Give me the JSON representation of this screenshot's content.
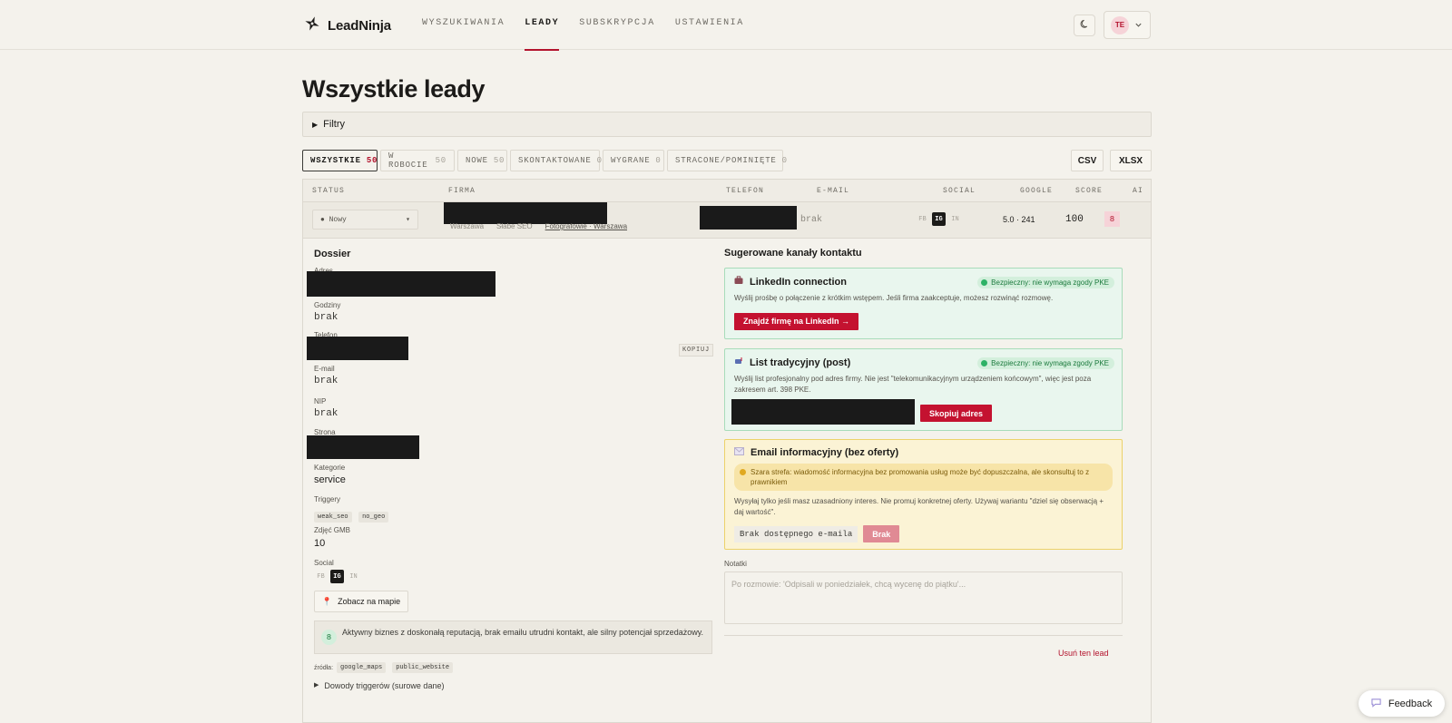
{
  "app": {
    "name": "LeadNinja"
  },
  "nav": {
    "items": [
      {
        "label": "WYSZUKIWANIA"
      },
      {
        "label": "LEADY"
      },
      {
        "label": "SUBSKRYPCJA"
      },
      {
        "label": "USTAWIENIA"
      }
    ],
    "user_initials": "TE"
  },
  "page": {
    "title": "Wszystkie leady",
    "filters_label": "Filtry"
  },
  "tabs": [
    {
      "label": "WSZYSTKIE",
      "count": "50"
    },
    {
      "label": "W ROBOCIE",
      "count": "50"
    },
    {
      "label": "NOWE",
      "count": "50"
    },
    {
      "label": "SKONTAKTOWANE",
      "count": "0"
    },
    {
      "label": "WYGRANE",
      "count": "0"
    },
    {
      "label": "STRACONE/POMINIĘTE",
      "count": "0"
    }
  ],
  "export": {
    "csv": "CSV",
    "xlsx": "XLSX"
  },
  "table": {
    "headers": {
      "status": "STATUS",
      "firma": "FIRMA",
      "telefon": "TELEFON",
      "email": "E-MAIL",
      "social": "SOCIAL",
      "google": "GOOGLE",
      "score": "SCORE",
      "ai": "AI"
    },
    "row": {
      "status": "Nowy",
      "firma_meta": {
        "city": "Warszawa",
        "tag": "Słabe SEO",
        "link": "Fotografowie · Warszawa"
      },
      "email": "brak",
      "social": {
        "fb": "FB",
        "ig": "IG",
        "in": "IN"
      },
      "google": "5.0 · 241",
      "score": "100",
      "ai": "8"
    }
  },
  "dossier": {
    "title": "Dossier",
    "adres_label": "Adres",
    "godziny_label": "Godziny",
    "godziny_value": "brak",
    "telefon_label": "Telefon",
    "copy_label": "KOPIUJ",
    "email_label": "E-mail",
    "email_value": "brak",
    "nip_label": "NIP",
    "nip_value": "brak",
    "strona_label": "Strona",
    "kategorie_label": "Kategorie",
    "kategorie_value": "service",
    "triggery_label": "Triggery",
    "triggery": [
      "weak_seo",
      "no_geo"
    ],
    "zdjecia_label": "Zdjęć GMB",
    "zdjecia_value": "10",
    "social_label": "Social",
    "map_button": "Zobacz na mapie",
    "ai_score": "8",
    "ai_summary": "Aktywny biznes z doskonałą reputacją, brak emailu utrudni kontakt, ale silny potencjał sprzedażowy.",
    "sources_label": "źródła:",
    "sources": [
      "google_maps",
      "public_website"
    ],
    "evidence_label": "Dowody triggerów (surowe dane)"
  },
  "channels": {
    "title": "Sugerowane kanały kontaktu",
    "items": [
      {
        "title": "LinkedIn connection",
        "badge": "Bezpieczny: nie wymaga zgody PKE",
        "desc": "Wyślij prośbę o połączenie z krótkim wstępem. Jeśli firma zaakceptuje, możesz rozwinąć rozmowę.",
        "button": "Znajdź firmę na LinkedIn →"
      },
      {
        "title": "List tradycyjny (post)",
        "badge": "Bezpieczny: nie wymaga zgody PKE",
        "desc": "Wyślij list profesjonalny pod adres firmy. Nie jest \"telekomunikacyjnym urządzeniem końcowym\", więc jest poza zakresem art. 398 PKE.",
        "button": "Skopiuj adres"
      },
      {
        "title": "Email informacyjny (bez oferty)",
        "warning": "Szara strefa: wiadomość informacyjna bez promowania usług może być dopuszczalna, ale skonsultuj to z prawnikiem",
        "desc": "Wysyłaj tylko jeśli masz uzasadniony interes. Nie promuj konkretnej oferty. Używaj wariantu \"dziel się obserwacją + daj wartość\".",
        "no_email": "Brak dostępnego e-maila",
        "button": "Brak"
      }
    ]
  },
  "notes": {
    "label": "Notatki",
    "placeholder": "Po rozmowie: 'Odpisali w poniedziałek, chcą wycenę do piątku'..."
  },
  "delete_label": "Usuń ten lead",
  "feedback_label": "Feedback",
  "colors": {
    "accent": "#c41230",
    "background": "#f4f2ec",
    "safe": "#1b7a3d",
    "warning": "#ecd26a"
  }
}
